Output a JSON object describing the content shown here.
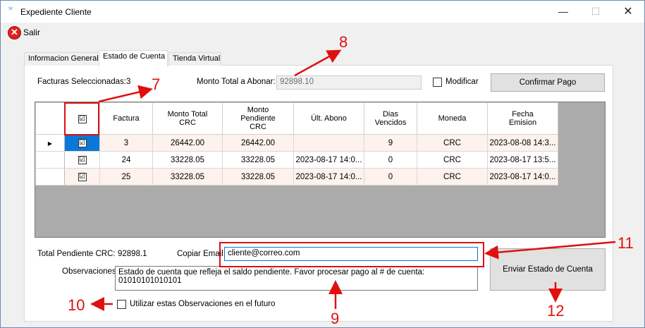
{
  "window": {
    "title": "Expediente Cliente",
    "app_icon_glyph": "W",
    "minimize_glyph": "—",
    "maximize_glyph": "☐",
    "close_glyph": "✕"
  },
  "menu": {
    "exit_label": "Salir",
    "exit_icon": "close-circle-icon"
  },
  "tabs": [
    {
      "label": "Informacion General"
    },
    {
      "label": "Estado de Cuenta"
    },
    {
      "label": "Tienda Virtual"
    }
  ],
  "active_tab": "Estado de Cuenta",
  "selection": {
    "selected_label": "Facturas Seleccionadas:",
    "selected_count": "3",
    "total_label": "Monto Total a Abonar:",
    "total_value": "92898.10",
    "modify_label": "Modificar",
    "modify_checked": false,
    "confirm_button": "Confirmar Pago"
  },
  "grid": {
    "header_checkbox": "☑",
    "columns": [
      "Factura",
      "Monto Total\nCRC",
      "Monto\nPendiente\nCRC",
      "Últ. Abono",
      "Dias\nVencidos",
      "Moneda",
      "Fecha\nEmision"
    ],
    "rows": [
      {
        "checked": "☑",
        "factura": "3",
        "monto_total": "26442.00",
        "monto_pendiente": "26442.00",
        "ult_abono": "",
        "dias_vencidos": "9",
        "moneda": "CRC",
        "fecha_emision": "2023-08-08 14:3..."
      },
      {
        "checked": "☑",
        "factura": "24",
        "monto_total": "33228.05",
        "monto_pendiente": "33228.05",
        "ult_abono": "2023-08-17 14:0...",
        "dias_vencidos": "0",
        "moneda": "CRC",
        "fecha_emision": "2023-08-17 13:5..."
      },
      {
        "checked": "☑",
        "factura": "25",
        "monto_total": "33228.05",
        "monto_pendiente": "33228.05",
        "ult_abono": "2023-08-17 14:0...",
        "dias_vencidos": "0",
        "moneda": "CRC",
        "fecha_emision": "2023-08-17 14:0..."
      }
    ],
    "current_row_glyph": "▶"
  },
  "footer": {
    "pending_label": "Total Pendiente CRC:",
    "pending_value": "92898.1",
    "email_label": "Copiar Email:",
    "email_value": "cliente@correo.com",
    "obs_label": "Observaciones:",
    "obs_value": "Estado de cuenta que refleja el saldo pendiente. Favor procesar pago al # de cuenta: 01010101010101",
    "future_obs_label": "Utilizar estas Observaciones en el futuro",
    "future_obs_checked": false,
    "send_button": "Enviar Estado de Cuenta"
  },
  "annotations": {
    "a7": "7",
    "a8": "8",
    "a9": "9",
    "a10": "10",
    "a11": "11",
    "a12": "12",
    "color": "#e01010"
  }
}
